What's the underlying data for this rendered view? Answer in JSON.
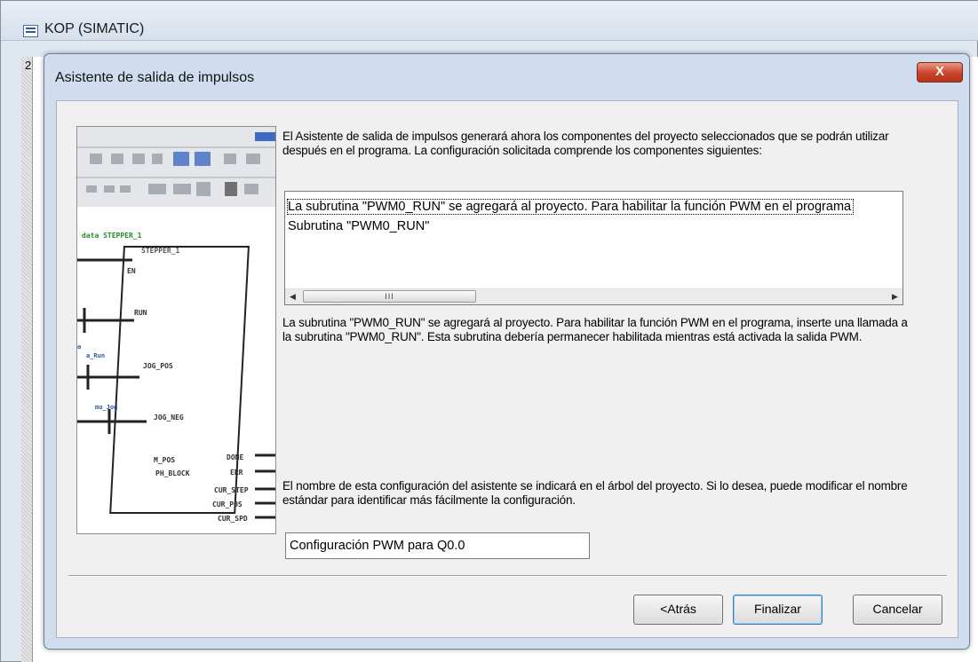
{
  "parent_window": {
    "title": "KOP (SIMATIC)",
    "row_label": "2",
    "icon": "ladder-editor-icon"
  },
  "dialog": {
    "title": "Asistente de salida de impulsos",
    "close_label": "X",
    "intro": "El Asistente de salida de impulsos generará ahora los componentes del proyecto seleccionados que se podrán utilizar después en el programa. La configuración solicitada comprende los componentes siguientes:",
    "list_items": [
      "La subrutina \"PWM0_RUN\" se agregará al proyecto. Para habilitar la función PWM en el programa",
      "Subrutina \"PWM0_RUN\""
    ],
    "scroll_thumb_label": "III",
    "detail": "La subrutina \"PWM0_RUN\" se agregará al proyecto. Para habilitar la función PWM en el programa, inserte una llamada a la subrutina \"PWM0_RUN\". Esta subrutina debería permanecer habilitada mientras está activada la salida PWM.",
    "name_info": "El nombre de esta configuración del asistente se indicará en el árbol del proyecto. Si lo desea, puede modificar el nombre estándar para identificar más fácilmente la configuración.",
    "config_name": "Configuración PWM para Q0.0",
    "buttons": {
      "back": "<Atrás",
      "finish": "Finalizar",
      "cancel": "Cancelar"
    }
  },
  "wizard_image": {
    "block_name": "STEPPER_1",
    "header_label": "STEPPER_1",
    "inputs": [
      "EN",
      "RUN",
      "JOG_POS",
      "JOG_NEG",
      "M_POS",
      "PH_BLOCK"
    ],
    "outputs": [
      "DONE",
      "ERR",
      "CUR_STEP",
      "CUR_POS",
      "CUR_SPD"
    ]
  }
}
